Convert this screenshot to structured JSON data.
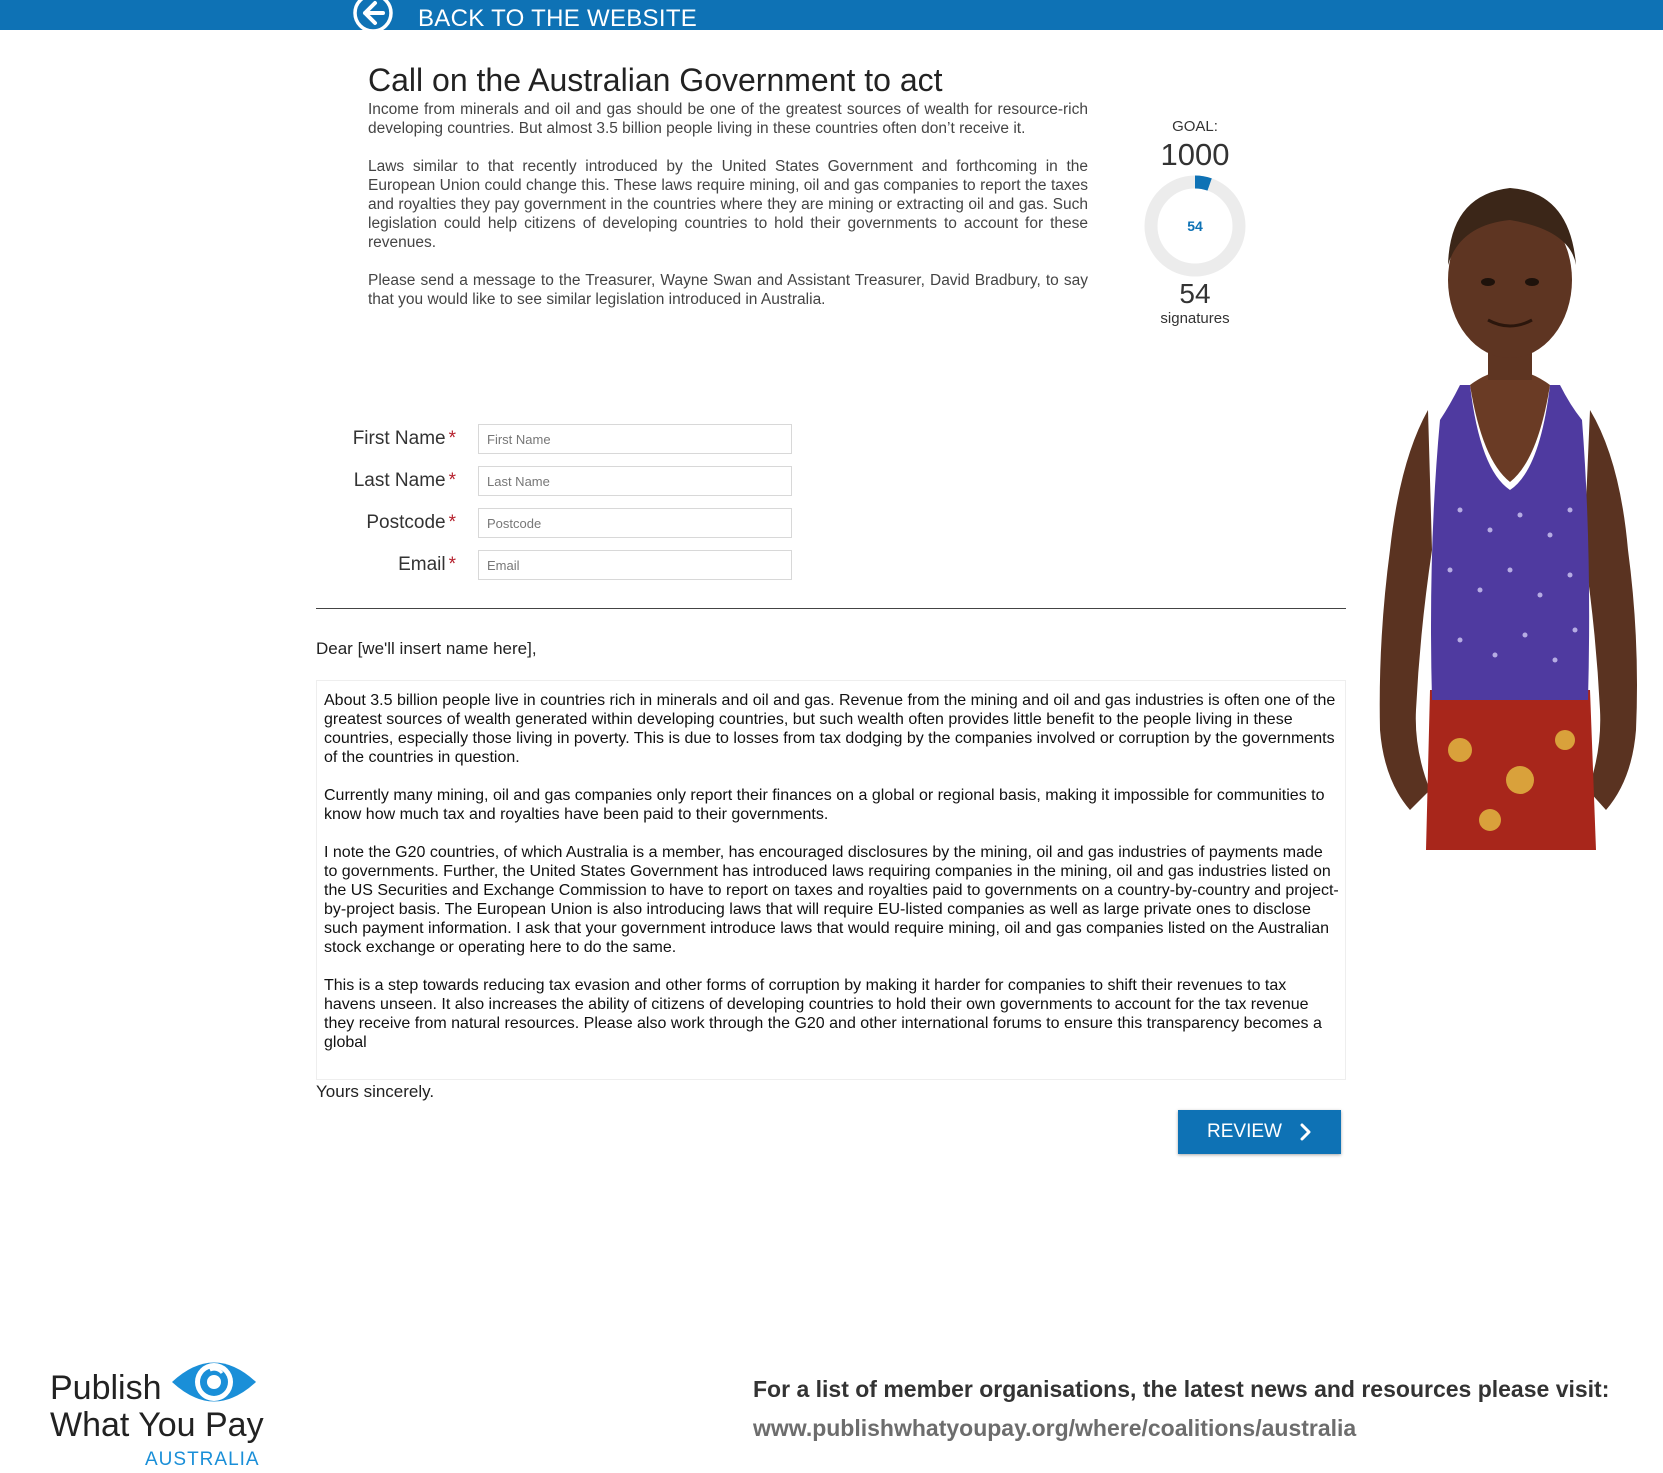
{
  "header": {
    "back_label": "BACK TO THE WEBSITE",
    "bar_color": "#0e72b5",
    "back_icon": "arrow-left-circle-icon"
  },
  "campaign": {
    "title": "Call on the Australian Government to act",
    "paragraphs": [
      "Income from minerals and oil and gas should be one of the greatest sources of wealth for resource-rich developing countries. But almost 3.5 billion people living in these countries often don’t receive it.",
      "Laws similar to that recently introduced by the United States Government and forthcoming in the European Union could change this. These laws require mining, oil and gas companies to report the taxes and royalties they pay government in the countries where they are mining or extracting oil and gas. Such legislation could help citizens of developing countries to hold their governments to account for these revenues.",
      "Please send a message to the Treasurer, Wayne Swan and Assistant Treasurer, David Bradbury, to say that you would like to see similar legislation introduced in Australia."
    ]
  },
  "goal": {
    "label": "GOAL:",
    "target": "1000",
    "current": "54",
    "center_value": "54",
    "signatures_label": "signatures",
    "progress_fraction": 0.054,
    "progress_color": "#0e72b5",
    "track_color": "#ececec"
  },
  "form": {
    "required_marker": "*",
    "fields": [
      {
        "label": "First Name",
        "placeholder": "First Name",
        "value": ""
      },
      {
        "label": "Last Name",
        "placeholder": "Last Name",
        "value": ""
      },
      {
        "label": "Postcode",
        "placeholder": "Postcode",
        "value": ""
      },
      {
        "label": "Email",
        "placeholder": "Email",
        "value": ""
      }
    ]
  },
  "letter": {
    "greeting": "Dear [we'll insert name here],",
    "paragraphs": [
      "About 3.5 billion people live in countries rich in minerals and oil and gas.  Revenue from the mining and oil and gas industries is often one of the greatest sources of wealth generated within developing countries, but such wealth often provides little benefit to the people living in these countries, especially those living in poverty. This is due to losses from tax dodging by the companies involved or corruption by the governments of the countries in question.",
      "Currently many mining, oil and gas companies only report their finances on a global or regional basis, making it impossible for communities to know how much tax and royalties have been paid to their governments.",
      "I note the G20 countries, of which Australia is a member, has encouraged disclosures by the mining, oil and gas industries of payments made to governments. Further, the United States Government has introduced laws requiring companies in the mining, oil and gas industries listed on the US Securities and Exchange Commission to have to report on taxes and royalties paid to governments on a country-by-country and project-by-project basis. The European Union is also introducing laws that will require EU-listed companies as well as large private ones to disclose such payment information. I ask that your government introduce laws that would require mining, oil and gas companies listed on the Australian stock exchange or operating here to do the same.",
      "This is a step towards reducing tax evasion and other forms of corruption by making it harder for companies to shift their revenues to tax havens unseen. It also increases the ability of citizens of developing countries to hold their own governments to account for the tax revenue they receive from natural resources. Please also work through the G20 and other international forums to ensure this transparency becomes a global"
    ],
    "signoff": "Yours sincerely.",
    "review_label": "REVIEW",
    "review_icon": "chevron-right-icon"
  },
  "logo": {
    "line1": "Publish",
    "line2": "What You Pay",
    "country": "AUSTRALIA",
    "icon": "eye-icon"
  },
  "footer": {
    "text": "For a list of member organisations, the latest news and resources please visit:",
    "url": "www.publishwhatyoupay.org/where/coalitions/australia"
  },
  "photo": {
    "icon": "girl-photo"
  }
}
